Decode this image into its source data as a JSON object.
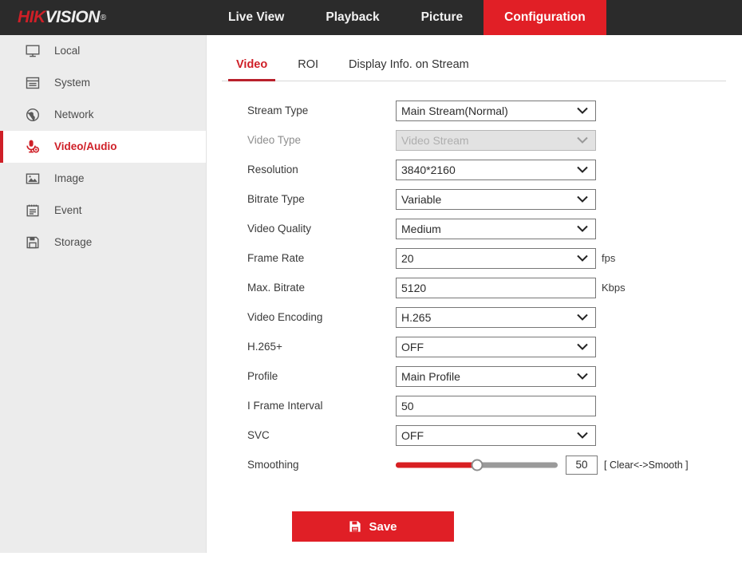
{
  "header": {
    "logo": {
      "part1": "HIK",
      "part2": "VISION",
      "reg": "®"
    },
    "nav": [
      {
        "label": "Live View",
        "active": false
      },
      {
        "label": "Playback",
        "active": false
      },
      {
        "label": "Picture",
        "active": false
      },
      {
        "label": "Configuration",
        "active": true
      }
    ],
    "accent_color": "#e11f26",
    "background_color": "#2b2b2b"
  },
  "sidebar": {
    "items": [
      {
        "label": "Local",
        "icon": "monitor-icon",
        "active": false
      },
      {
        "label": "System",
        "icon": "window-icon",
        "active": false
      },
      {
        "label": "Network",
        "icon": "globe-icon",
        "active": false
      },
      {
        "label": "Video/Audio",
        "icon": "microphone-icon",
        "active": true
      },
      {
        "label": "Image",
        "icon": "picture-icon",
        "active": false
      },
      {
        "label": "Event",
        "icon": "notepad-icon",
        "active": false
      },
      {
        "label": "Storage",
        "icon": "floppy-disk-icon",
        "active": false
      }
    ],
    "active_color": "#cf1f27",
    "background_color": "#ececec"
  },
  "main": {
    "tabs": [
      {
        "label": "Video",
        "active": true
      },
      {
        "label": "ROI",
        "active": false
      },
      {
        "label": "Display Info. on Stream",
        "active": false
      }
    ],
    "fields": {
      "stream_type": {
        "label": "Stream Type",
        "value": "Main Stream(Normal)",
        "unit": ""
      },
      "video_type": {
        "label": "Video Type",
        "value": "Video Stream",
        "unit": ""
      },
      "resolution": {
        "label": "Resolution",
        "value": "3840*2160",
        "unit": ""
      },
      "bitrate_type": {
        "label": "Bitrate Type",
        "value": "Variable",
        "unit": ""
      },
      "video_quality": {
        "label": "Video Quality",
        "value": "Medium",
        "unit": ""
      },
      "frame_rate": {
        "label": "Frame Rate",
        "value": "20",
        "unit": "fps"
      },
      "max_bitrate": {
        "label": "Max. Bitrate",
        "value": "5120",
        "unit": "Kbps"
      },
      "video_encoding": {
        "label": "Video Encoding",
        "value": "H.265",
        "unit": ""
      },
      "h265_plus": {
        "label": "H.265+",
        "value": "OFF",
        "unit": ""
      },
      "profile": {
        "label": "Profile",
        "value": "Main Profile",
        "unit": ""
      },
      "i_frame_interval": {
        "label": "I Frame Interval",
        "value": "50",
        "unit": ""
      },
      "svc": {
        "label": "SVC",
        "value": "OFF",
        "unit": ""
      },
      "smoothing": {
        "label": "Smoothing",
        "value": "50",
        "hint": "[ Clear<->Smooth ]",
        "percent": 50
      }
    },
    "save": {
      "label": "Save",
      "icon": "save-floppy-icon",
      "color": "#e01f26"
    }
  }
}
